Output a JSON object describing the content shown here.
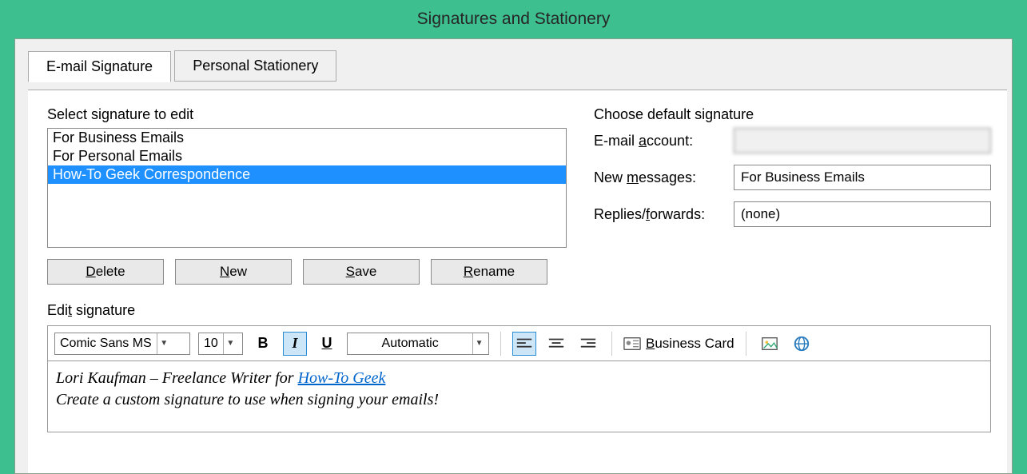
{
  "window": {
    "title": "Signatures and Stationery"
  },
  "tabs": {
    "email_signature": {
      "prefix": "E",
      "rest": "-mail Signature"
    },
    "personal_stationery": {
      "prefix": "P",
      "rest": "ersonal Stationery"
    }
  },
  "left": {
    "group_title": "Select signature to edit",
    "items": [
      "For Business Emails",
      "For Personal Emails",
      "How-To Geek Correspondence"
    ],
    "buttons": {
      "delete": {
        "accel": "D",
        "rest": "elete"
      },
      "new": {
        "accel": "N",
        "rest": "ew"
      },
      "save": {
        "accel": "S",
        "rest": "ave"
      },
      "rename": {
        "accel": "R",
        "rest": "ename"
      }
    }
  },
  "right": {
    "group_title": "Choose default signature",
    "email_account": {
      "label_pre": "E-mail ",
      "accel": "a",
      "label_post": "ccount:",
      "value": ""
    },
    "new_messages": {
      "label_pre": "New ",
      "accel": "m",
      "label_post": "essages:",
      "value": "For Business Emails"
    },
    "replies": {
      "label_pre": "Replies/",
      "accel": "f",
      "label_post": "orwards:",
      "value": "(none)"
    }
  },
  "edit": {
    "group_title_pre": "Edi",
    "group_title_accel": "t",
    "group_title_post": " signature",
    "font_name": "Comic Sans MS",
    "font_size": "10",
    "font_color_label": "Automatic",
    "business_card_accel": "B",
    "business_card_rest": "usiness Card",
    "content": {
      "line1_pre": "Lori Kaufman – Freelance Writer for ",
      "line1_link": "How-To Geek",
      "line2": "Create a custom signature to use when signing your emails!"
    }
  }
}
